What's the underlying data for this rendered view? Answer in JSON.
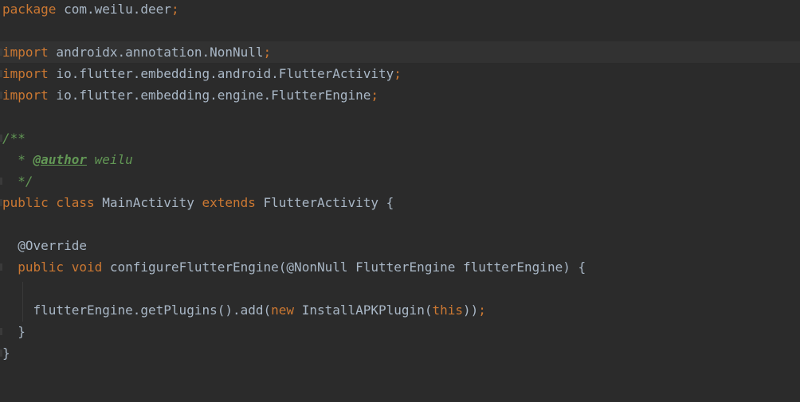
{
  "editor": {
    "lines": [
      {
        "tokens": [
          {
            "t": "package",
            "c": "kw"
          },
          {
            "t": " com.weilu.deer",
            "c": "plain"
          },
          {
            "t": ";",
            "c": "kw"
          }
        ]
      },
      {
        "tokens": []
      },
      {
        "tokens": [
          {
            "t": "import",
            "c": "kw"
          },
          {
            "t": " androidx.annotation.NonNull",
            "c": "plain"
          },
          {
            "t": ";",
            "c": "kw"
          }
        ],
        "current": true
      },
      {
        "tokens": [
          {
            "t": "import",
            "c": "kw"
          },
          {
            "t": " io.flutter.embedding.android.FlutterActivity",
            "c": "plain"
          },
          {
            "t": ";",
            "c": "kw"
          }
        ]
      },
      {
        "tokens": [
          {
            "t": "import",
            "c": "kw"
          },
          {
            "t": " io.flutter.embedding.engine.FlutterEngine",
            "c": "plain"
          },
          {
            "t": ";",
            "c": "kw"
          }
        ]
      },
      {
        "tokens": []
      },
      {
        "tokens": [
          {
            "t": "/**",
            "c": "cm"
          }
        ]
      },
      {
        "tokens": [
          {
            "t": "  * ",
            "c": "cm"
          },
          {
            "t": "@author",
            "c": "tag"
          },
          {
            "t": " weilu",
            "c": "cm"
          }
        ]
      },
      {
        "tokens": [
          {
            "t": "  */",
            "c": "cm"
          }
        ]
      },
      {
        "tokens": [
          {
            "t": "public class",
            "c": "kw"
          },
          {
            "t": " MainActivity ",
            "c": "plain"
          },
          {
            "t": "extends",
            "c": "kw"
          },
          {
            "t": " FlutterActivity {",
            "c": "plain"
          }
        ]
      },
      {
        "tokens": []
      },
      {
        "tokens": [
          {
            "t": "  @Override",
            "c": "ann-plain"
          }
        ]
      },
      {
        "tokens": [
          {
            "t": "  ",
            "c": "plain"
          },
          {
            "t": "public void",
            "c": "kw"
          },
          {
            "t": " configureFlutterEngine(",
            "c": "plain"
          },
          {
            "t": "@NonNull",
            "c": "ann-plain"
          },
          {
            "t": " FlutterEngine flutterEngine) {",
            "c": "plain"
          }
        ]
      },
      {
        "tokens": []
      },
      {
        "tokens": [
          {
            "t": "    flutterEngine.getPlugins().add(",
            "c": "plain"
          },
          {
            "t": "new",
            "c": "kw"
          },
          {
            "t": " InstallAPKPlugin(",
            "c": "plain"
          },
          {
            "t": "this",
            "c": "kw"
          },
          {
            "t": "))",
            "c": "plain"
          },
          {
            "t": ";",
            "c": "kw"
          }
        ]
      },
      {
        "tokens": [
          {
            "t": "  }",
            "c": "plain"
          }
        ]
      },
      {
        "tokens": [
          {
            "t": "}",
            "c": "plain"
          }
        ]
      }
    ]
  }
}
